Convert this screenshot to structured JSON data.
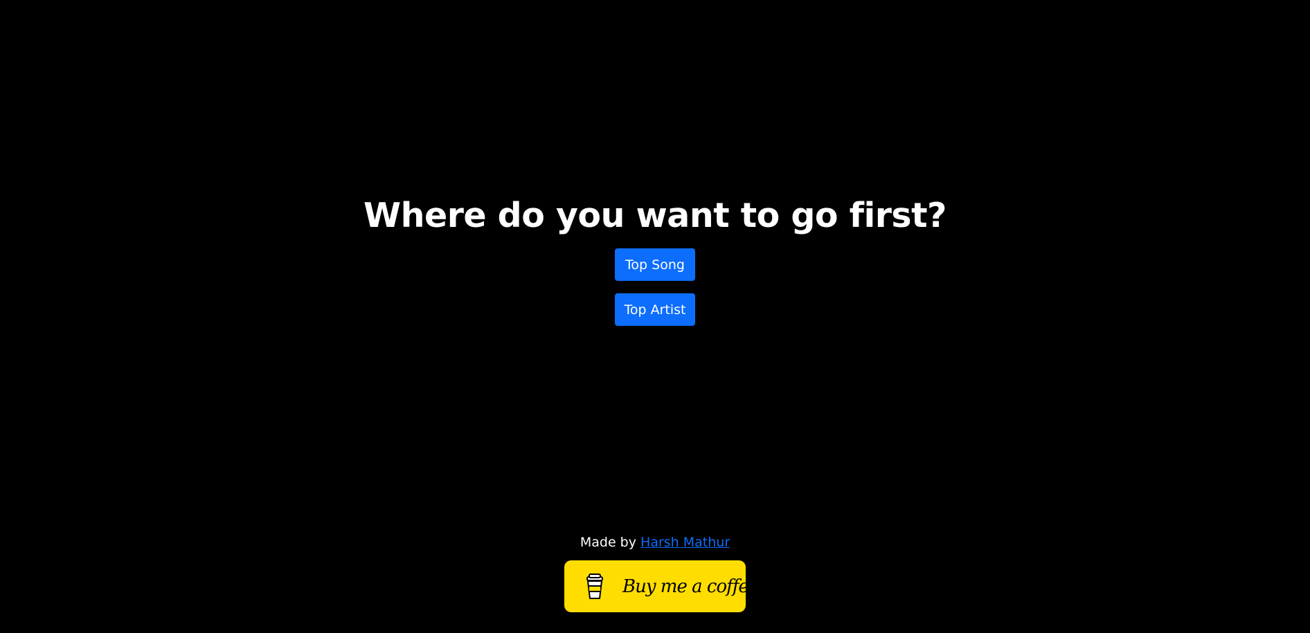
{
  "main": {
    "heading": "Where do you want to go first?",
    "buttons": {
      "top_song": "Top Song",
      "top_artist": "Top Artist"
    }
  },
  "footer": {
    "made_by": "Made by",
    "author": "Harsh Mathur",
    "coffee_label": "Buy me a coffee"
  },
  "colors": {
    "background": "#000000",
    "primary_button": "#0d6efd",
    "link": "#0d6efd",
    "coffee_button": "#ffdd00"
  },
  "icons": {
    "coffee": "coffee-cup-icon"
  }
}
